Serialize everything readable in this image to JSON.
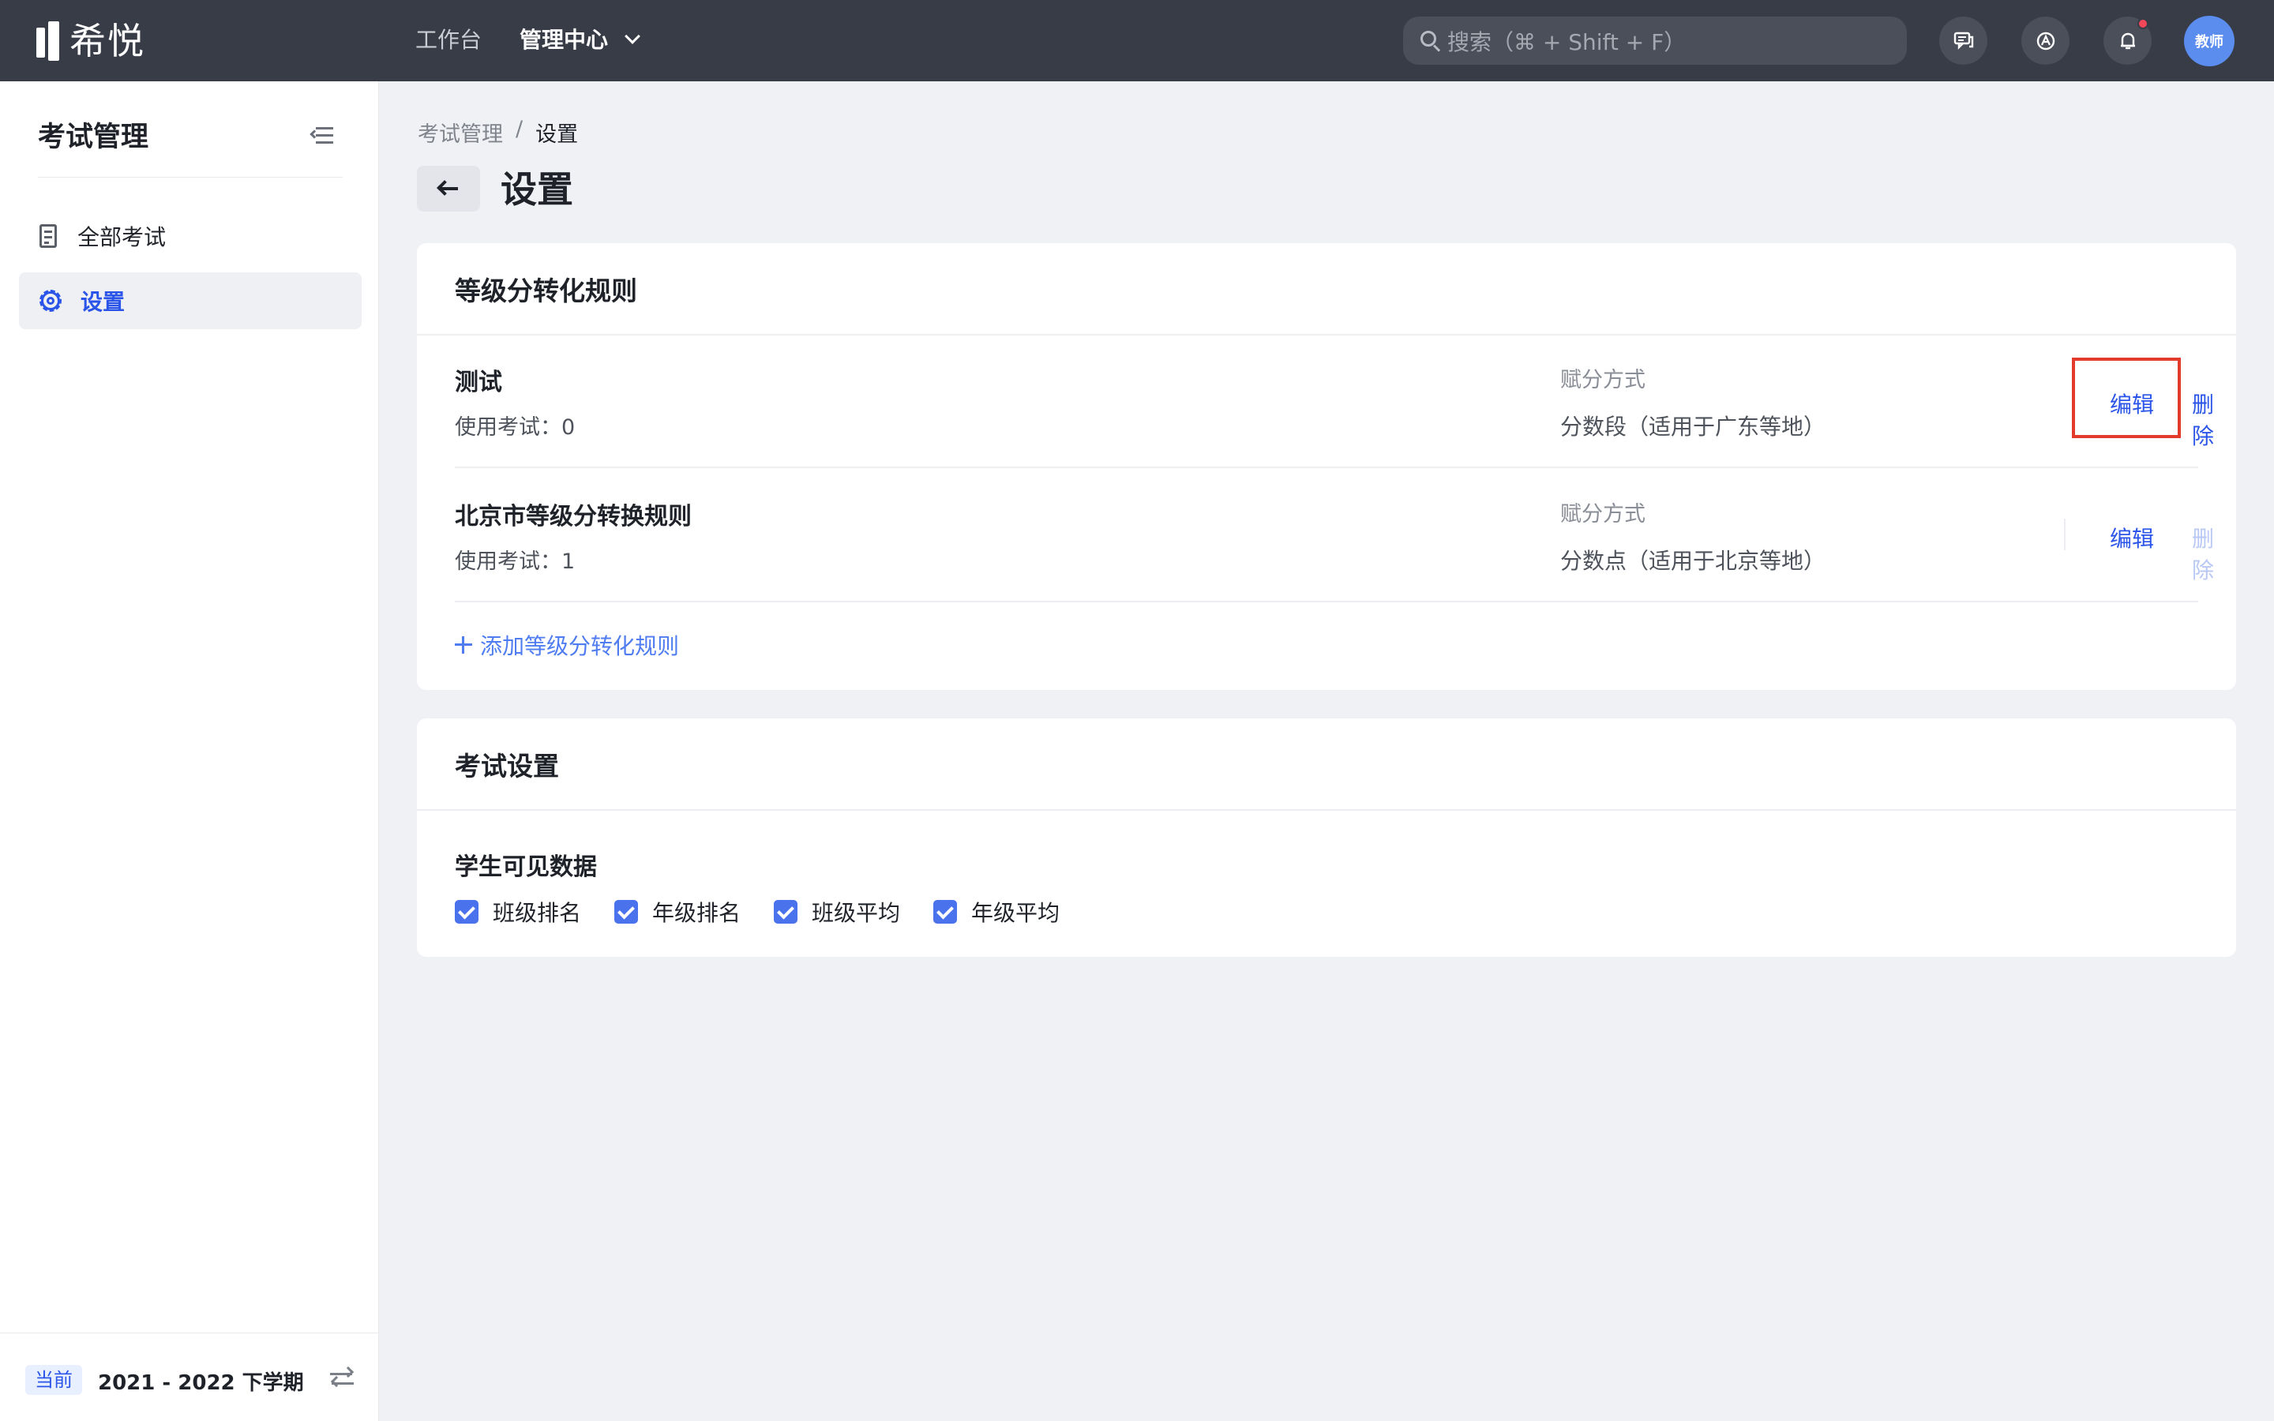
{
  "app": {
    "logo_text": "希悦"
  },
  "topnav": {
    "items": [
      {
        "label": "工作台",
        "active": false
      },
      {
        "label": "管理中心",
        "active": true
      }
    ]
  },
  "search": {
    "placeholder": "搜索（⌘ + Shift + F）"
  },
  "header_icons": [
    "chat-icon",
    "assistant-icon",
    "bell-icon"
  ],
  "user": {
    "avatar_label": "教师"
  },
  "sidebar": {
    "title": "考试管理",
    "items": [
      {
        "label": "全部考试",
        "icon": "exam-list-icon",
        "active": false
      },
      {
        "label": "设置",
        "icon": "gear-icon",
        "active": true
      }
    ],
    "footer": {
      "tag": "当前",
      "term": "2021 - 2022 下学期"
    }
  },
  "breadcrumb": {
    "parent": "考试管理",
    "separator": "/",
    "current": "设置"
  },
  "page": {
    "title": "设置"
  },
  "grade_rules": {
    "title": "等级分转化规则",
    "rules": [
      {
        "name": "测试",
        "usage": "使用考试：0",
        "score_label": "赋分方式",
        "score_value": "分数段（适用于广东等地）",
        "edit": "编辑",
        "delete": "删除",
        "delete_enabled": true
      },
      {
        "name": "北京市等级分转换规则",
        "usage": "使用考试：1",
        "score_label": "赋分方式",
        "score_value": "分数点（适用于北京等地）",
        "edit": "编辑",
        "delete": "删除",
        "delete_enabled": false
      }
    ],
    "add_label": "添加等级分转化规则"
  },
  "exam_settings": {
    "title": "考试设置",
    "section_label": "学生可见数据",
    "options": [
      {
        "label": "班级排名",
        "checked": true
      },
      {
        "label": "年级排名",
        "checked": true
      },
      {
        "label": "班级平均",
        "checked": true
      },
      {
        "label": "年级平均",
        "checked": true
      }
    ]
  },
  "colors": {
    "topbar": "#373c47",
    "accent": "#2b55e8",
    "highlight": "#e23b2b",
    "notification": "#f5475a"
  }
}
